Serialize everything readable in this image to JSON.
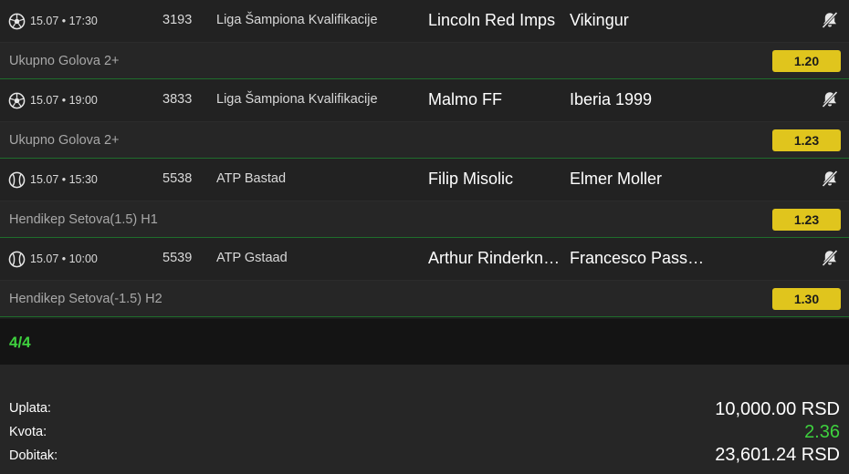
{
  "matches": [
    {
      "sport_icon": "soccer-ball-icon",
      "time": "15.07 • 17:30",
      "code": "3193",
      "league": "Liga Šampiona Kvalifikacije",
      "home": "Lincoln Red Imps",
      "away": "Vikingur",
      "bet": "Ukupno Golova 2+",
      "odd": "1.20"
    },
    {
      "sport_icon": "soccer-ball-icon",
      "time": "15.07 • 19:00",
      "code": "3833",
      "league": "Liga Šampiona Kvalifikacije",
      "home": "Malmo FF",
      "away": "Iberia 1999",
      "bet": "Ukupno Golova 2+",
      "odd": "1.23"
    },
    {
      "sport_icon": "tennis-ball-icon",
      "time": "15.07 • 15:30",
      "code": "5538",
      "league": "ATP Bastad",
      "home": "Filip Misolic",
      "away": "Elmer Moller",
      "bet": "Hendikep Setova(1.5) H1",
      "odd": "1.23"
    },
    {
      "sport_icon": "tennis-ball-icon",
      "time": "15.07 • 10:00",
      "code": "5539",
      "league": "ATP Gstaad",
      "home": "Arthur Rinderknech",
      "away": "Francesco Passaro",
      "bet": "Hendikep Setova(-1.5) H2",
      "odd": "1.30"
    }
  ],
  "count": "4/4",
  "summary": {
    "stake_label": "Uplata:",
    "stake_value": "10,000.00 RSD",
    "odds_label": "Kvota:",
    "odds_value": "2.36",
    "win_label": "Dobitak:",
    "win_value": "23,601.24 RSD"
  },
  "colors": {
    "odd_badge": "#e0c51d",
    "accent_green": "#3ed13e",
    "divider_green": "#1f6e2c"
  }
}
